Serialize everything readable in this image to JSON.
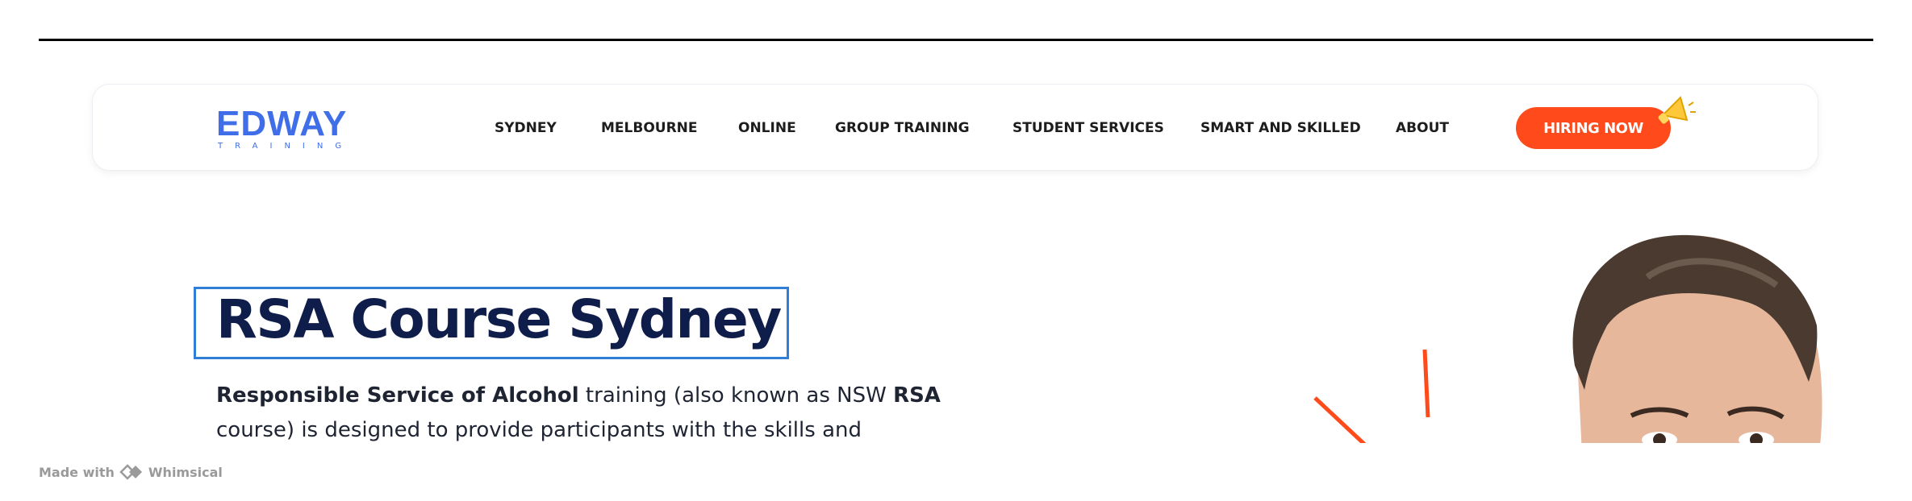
{
  "brand": {
    "name": "EDWAY",
    "sub": "TRAINING",
    "color": "#3f6ee8"
  },
  "nav": {
    "items": [
      {
        "label": "SYDNEY"
      },
      {
        "label": "MELBOURNE"
      },
      {
        "label": "ONLINE"
      },
      {
        "label": "GROUP TRAINING"
      },
      {
        "label": "STUDENT SERVICES"
      },
      {
        "label": "SMART AND SKILLED"
      },
      {
        "label": "ABOUT"
      }
    ],
    "cta_label": "HIRING NOW",
    "cta_color": "#ff4a1c"
  },
  "hero": {
    "title": "RSA Course Sydney",
    "para_bold1": "Responsible Service of Alcohol",
    "para_text1": " training (also known as NSW ",
    "para_bold2": "RSA",
    "para_text2": " course) is designed to provide participants with the skills and"
  },
  "footer": {
    "made_with": "Made with",
    "tool": "Whimsical"
  },
  "icons": [
    "megaphone-icon",
    "whimsical-logo-icon"
  ]
}
